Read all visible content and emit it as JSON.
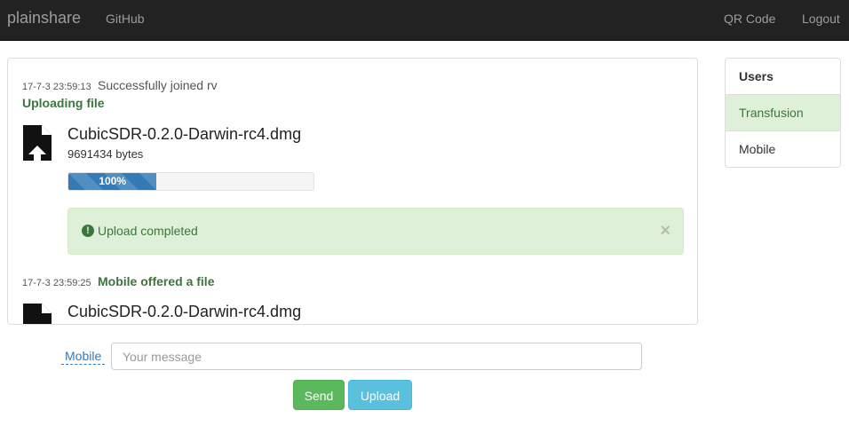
{
  "navbar": {
    "brand": "plainshare",
    "links": {
      "github": "GitHub",
      "qr_code": "QR Code",
      "logout": "Logout"
    }
  },
  "chat": {
    "messages": [
      {
        "timestamp": "17-7-3 23:59:13",
        "text": "Successfully joined rv"
      },
      {
        "status": "Uploading file",
        "file_name": "CubicSDR-0.2.0-Darwin-rc4.dmg",
        "file_size": "9691434 bytes",
        "progress_label": "100%",
        "progress_percent": 100,
        "alert": {
          "text": "Upload completed",
          "icon": "exclamation-circle-icon",
          "close": "×"
        }
      },
      {
        "timestamp": "17-7-3 23:59:25",
        "text": "Mobile offered a file",
        "file_name": "CubicSDR-0.2.0-Darwin-rc4.dmg"
      }
    ]
  },
  "users": {
    "heading": "Users",
    "items": [
      {
        "label": "Transfusion",
        "active": true
      },
      {
        "label": "Mobile",
        "active": false
      }
    ]
  },
  "compose": {
    "recipient": "Mobile",
    "placeholder": "Your message",
    "send_label": "Send",
    "upload_label": "Upload"
  },
  "colors": {
    "navbar": "#222222",
    "success_text": "#3c763d",
    "success_bg": "#dff0d8",
    "primary": "#337ab7",
    "send_button": "#5cb85c",
    "upload_button": "#5bc0de"
  }
}
